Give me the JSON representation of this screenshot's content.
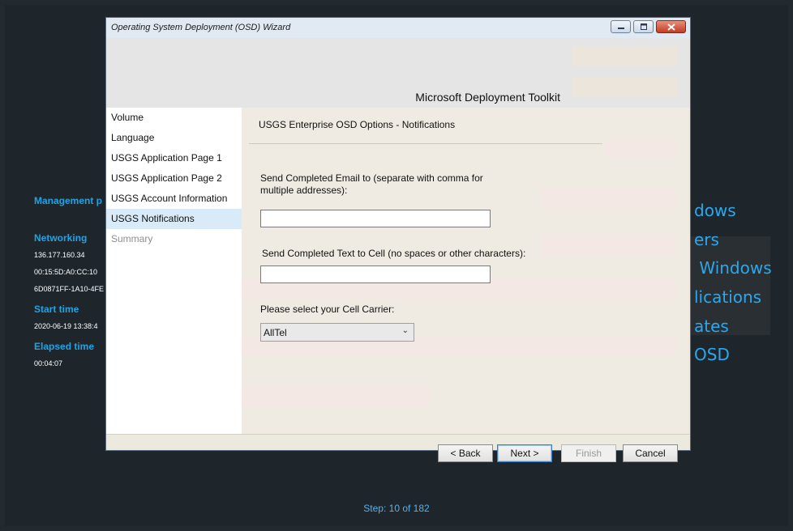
{
  "background": {
    "left_panel": {
      "management_label": "Management p",
      "networking_label": "Networking",
      "ip_address": "136.177.160.34",
      "mac_address": "00:15:5D:A0:CC:10",
      "uuid": "6D0871FF-1A10-4FE",
      "start_time_label": "Start time",
      "start_time_value": "2020-06-19 13:38:4",
      "elapsed_time_label": "Elapsed time",
      "elapsed_time_value": "00:04:07"
    },
    "right_items": [
      "dows",
      "ers",
      " Windows",
      "lications",
      "ates",
      "OSD"
    ],
    "step_text": "Step: 10 of 182"
  },
  "window": {
    "title": "Operating System Deployment (OSD) Wizard",
    "brand": "Microsoft Deployment Toolkit"
  },
  "nav": {
    "items": [
      {
        "label": "Volume"
      },
      {
        "label": "Language"
      },
      {
        "label": "USGS Application Page 1"
      },
      {
        "label": "USGS Application Page 2"
      },
      {
        "label": "USGS Account Information"
      },
      {
        "label": "USGS Notifications"
      },
      {
        "label": "Summary"
      }
    ]
  },
  "page": {
    "title": "USGS Enterprise OSD Options - Notifications",
    "email_label_line1": "Send Completed Email to (separate with comma for",
    "email_label_line2": "multiple addresses):",
    "email_value": "",
    "text_label": "Send Completed Text to Cell (no spaces or other characters):",
    "text_value": "",
    "carrier_label": "Please select your Cell Carrier:",
    "carrier_selected": "AllTel"
  },
  "buttons": {
    "back": "< Back",
    "next": "Next >",
    "finish": "Finish",
    "cancel": "Cancel"
  },
  "colors": {
    "accent": "#1fa3e6",
    "selection": "#d9ebf8",
    "close_button": "#c63a22"
  }
}
